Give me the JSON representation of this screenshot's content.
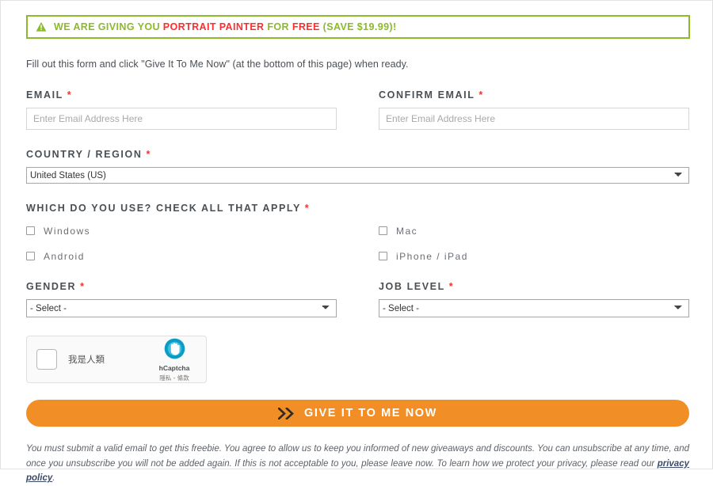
{
  "banner": {
    "icon": "warning-triangle-icon",
    "prefix": "WE ARE GIVING YOU ",
    "product": "PORTRAIT PAINTER",
    "middle": " FOR ",
    "free": "FREE",
    "suffix": " (SAVE $19.99)!",
    "border_color": "#8cba2a",
    "text_color": "#8cba2a",
    "highlight_color": "#ff2d2d"
  },
  "intro": {
    "text": "Fill out this form and click \"Give It To Me Now\" (at the bottom of this page) when ready."
  },
  "form": {
    "required_marker": "*",
    "email": {
      "label": "EMAIL",
      "placeholder": "Enter Email Address Here",
      "value": ""
    },
    "confirm_email": {
      "label": "CONFIRM EMAIL",
      "placeholder": "Enter Email Address Here",
      "value": ""
    },
    "country": {
      "label": "COUNTRY / REGION",
      "selected": "United States (US)"
    },
    "platforms": {
      "label": "WHICH DO YOU USE? CHECK ALL THAT APPLY",
      "options": [
        {
          "label": "Windows",
          "checked": false
        },
        {
          "label": "Mac",
          "checked": false
        },
        {
          "label": "Android",
          "checked": false
        },
        {
          "label": "iPhone / iPad",
          "checked": false
        }
      ]
    },
    "gender": {
      "label": "GENDER",
      "selected": "- Select -"
    },
    "job_level": {
      "label": "JOB LEVEL",
      "selected": "- Select -"
    }
  },
  "captcha": {
    "checkbox_label": "我是人類",
    "brand": "hCaptcha",
    "terms": "隱私 - 條款",
    "logo_color": "#0a9cc4"
  },
  "cta": {
    "label": "GIVE IT TO ME NOW",
    "icon": "double-chevron-right-icon",
    "background": "#f18e26"
  },
  "footer": {
    "part1": "You must submit a valid email to get this freebie. You agree to allow us to keep you informed of new giveaways and discounts. You can unsubscribe at any time, and once you unsubscribe you will not be added again. If this is not acceptable to you, please leave now. To learn how we protect your privacy, please read our ",
    "link": "privacy policy",
    "part2": "."
  }
}
